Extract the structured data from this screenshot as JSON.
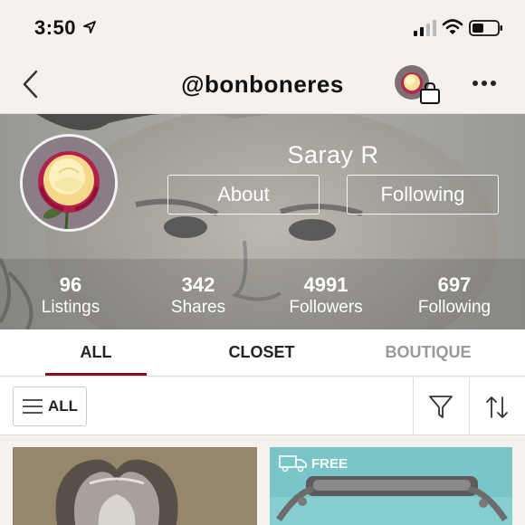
{
  "status_bar": {
    "time": "3:50"
  },
  "header": {
    "handle": "@bonboneres"
  },
  "profile": {
    "name": "Saray R",
    "about_label": "About",
    "following_button_label": "Following",
    "stats": [
      {
        "value": "96",
        "label": "Listings"
      },
      {
        "value": "342",
        "label": "Shares"
      },
      {
        "value": "4991",
        "label": "Followers"
      },
      {
        "value": "697",
        "label": "Following"
      }
    ]
  },
  "tabs": [
    {
      "label": "ALL",
      "active": true
    },
    {
      "label": "CLOSET",
      "active": false
    },
    {
      "label": "BOUTIQUE",
      "active": false
    }
  ],
  "filters": {
    "all_label": "ALL"
  },
  "listings": [
    {
      "badge": ""
    },
    {
      "badge": "FREE"
    }
  ],
  "colors": {
    "accent": "#7f0f22",
    "inactive_tab": "#999999"
  },
  "icons": [
    "location-arrow-icon",
    "signal-icon",
    "wifi-icon",
    "battery-icon",
    "back-chevron-icon",
    "shopping-bag-icon",
    "more-icon",
    "menu-lines-icon",
    "filter-funnel-icon",
    "sort-arrows-icon",
    "shipping-truck-icon"
  ]
}
